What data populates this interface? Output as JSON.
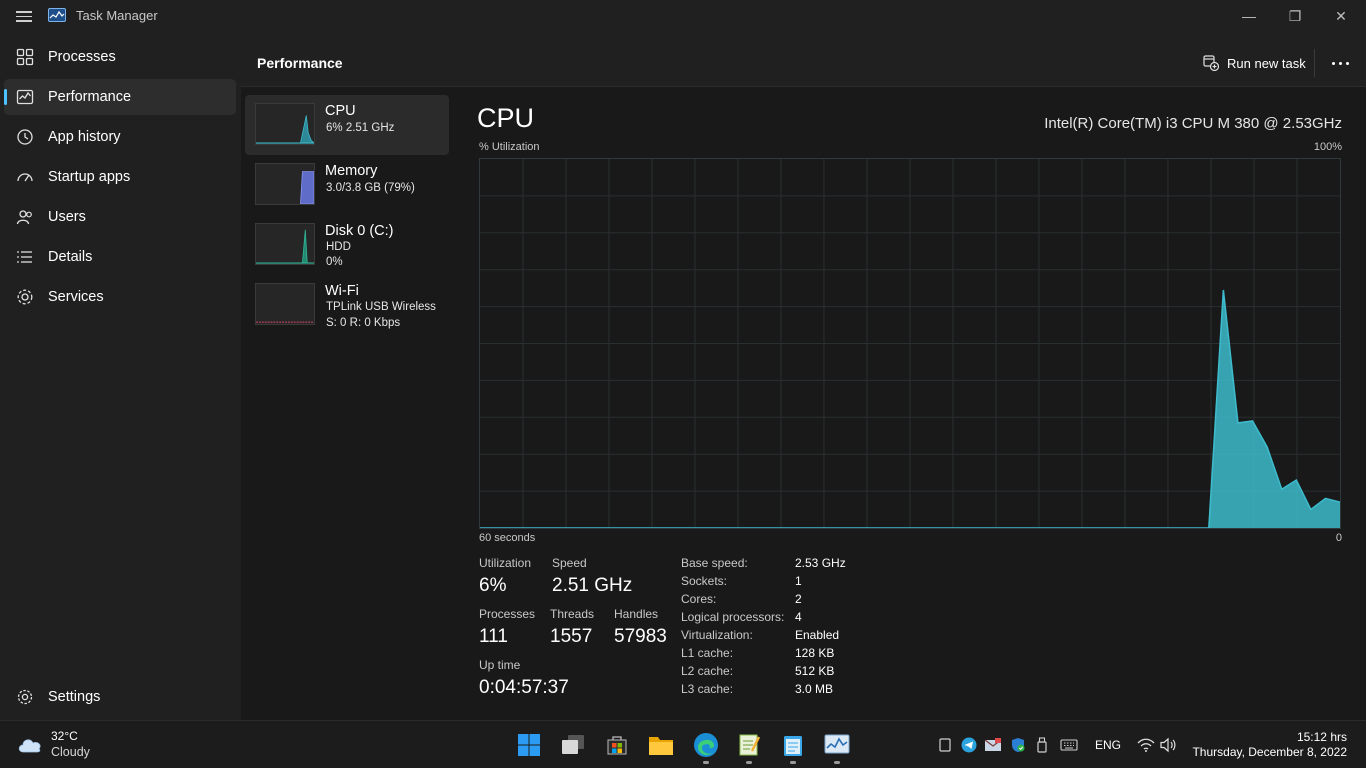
{
  "app": {
    "title": "Task Manager"
  },
  "window_controls": {
    "minimize": "—",
    "restore": "❐",
    "close": "✕"
  },
  "sidebar": {
    "items": [
      {
        "label": "Processes",
        "icon": "processes-icon",
        "active": false
      },
      {
        "label": "Performance",
        "icon": "performance-icon",
        "active": true
      },
      {
        "label": "App history",
        "icon": "app-history-icon",
        "active": false
      },
      {
        "label": "Startup apps",
        "icon": "startup-apps-icon",
        "active": false
      },
      {
        "label": "Users",
        "icon": "users-icon",
        "active": false
      },
      {
        "label": "Details",
        "icon": "details-icon",
        "active": false
      },
      {
        "label": "Services",
        "icon": "services-icon",
        "active": false
      }
    ],
    "settings_label": "Settings"
  },
  "header": {
    "title": "Performance",
    "run_new_task": "Run new task",
    "more_icon": "more-options-icon"
  },
  "devices": [
    {
      "name": "CPU",
      "lines": [
        "6% 2.51 GHz"
      ],
      "color": "#3dbccd",
      "active": true
    },
    {
      "name": "Memory",
      "lines": [
        "3.0/3.8 GB (79%)"
      ],
      "color": "#7b8cf2",
      "active": false
    },
    {
      "name": "Disk 0 (C:)",
      "lines": [
        "HDD",
        "0%"
      ],
      "color": "#2fb89a",
      "active": false
    },
    {
      "name": "Wi-Fi",
      "lines": [
        "TPLink USB Wireless",
        "S: 0 R: 0 Kbps"
      ],
      "color": "#d9476f",
      "active": false
    }
  ],
  "cpu": {
    "title": "CPU",
    "model": "Intel(R) Core(TM) i3 CPU M 380 @ 2.53GHz",
    "graph_label_left": "% Utilization",
    "graph_label_right": "100%",
    "graph_bottom_left": "60 seconds",
    "graph_bottom_right": "0",
    "graph_color": "#3dbccd",
    "utilization_history_percent": [
      0,
      0,
      0,
      0,
      0,
      0,
      0,
      0,
      0,
      0,
      0,
      0,
      0,
      0,
      0,
      0,
      0,
      0,
      0,
      0,
      0,
      0,
      0,
      0,
      0,
      0,
      0,
      0,
      0,
      0,
      0,
      0,
      0,
      0,
      0,
      0,
      0,
      0,
      0,
      0,
      0,
      0,
      0,
      0,
      0,
      0,
      0,
      0,
      0,
      0,
      0,
      64.5,
      28.5,
      29,
      22,
      10.5,
      13,
      5,
      8,
      7
    ],
    "stats": {
      "utilization": {
        "label": "Utilization",
        "value": "6%"
      },
      "speed": {
        "label": "Speed",
        "value": "2.51 GHz"
      },
      "processes": {
        "label": "Processes",
        "value": "111"
      },
      "threads": {
        "label": "Threads",
        "value": "1557"
      },
      "handles": {
        "label": "Handles",
        "value": "57983"
      },
      "uptime": {
        "label": "Up time",
        "value": "0:04:57:37"
      }
    },
    "specs": [
      {
        "label": "Base speed:",
        "value": "2.53 GHz"
      },
      {
        "label": "Sockets:",
        "value": "1"
      },
      {
        "label": "Cores:",
        "value": "2"
      },
      {
        "label": "Logical processors:",
        "value": "4"
      },
      {
        "label": "Virtualization:",
        "value": "Enabled"
      },
      {
        "label": "L1 cache:",
        "value": "128 KB"
      },
      {
        "label": "L2 cache:",
        "value": "512 KB"
      },
      {
        "label": "L3 cache:",
        "value": "3.0 MB"
      }
    ]
  },
  "taskbar": {
    "weather": {
      "temp": "32°C",
      "condition": "Cloudy"
    },
    "apps": [
      "start-icon",
      "task-view-icon",
      "store-icon",
      "file-explorer-icon",
      "edge-icon",
      "notepad-plus-icon",
      "notepad-icon",
      "task-manager-icon"
    ],
    "tray": [
      "tablet-mode-icon",
      "telegram-icon",
      "mail-icon",
      "security-icon",
      "usb-icon",
      "keyboard-icon"
    ],
    "language": "ENG",
    "time": "15:12 hrs",
    "date": "Thursday, December 8, 2022"
  }
}
